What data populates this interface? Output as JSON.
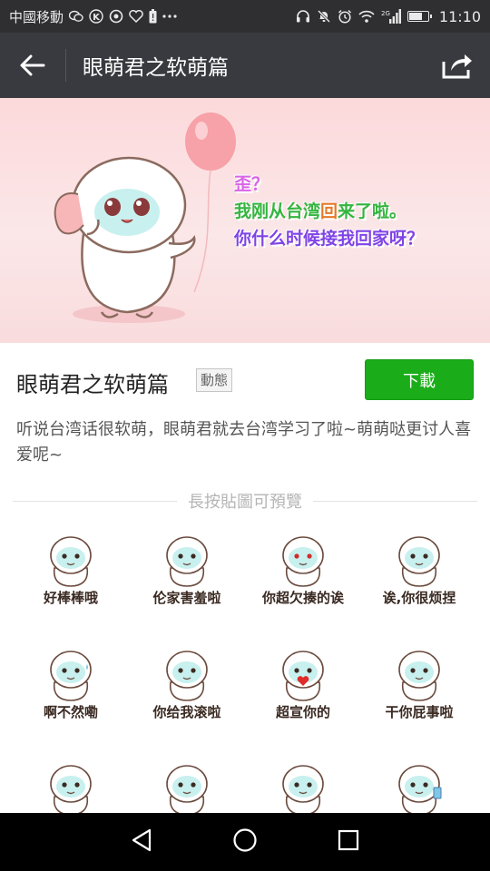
{
  "status_bar": {
    "carrier": "中國移動",
    "signal": "2G",
    "time": "11:10",
    "battery_level": 0.75,
    "icons": [
      "wechat-icon",
      "k-icon",
      "sync-icon",
      "heart-icon",
      "battery-alert-icon",
      "more-icon",
      "headset-icon",
      "mute-icon",
      "alarm-icon",
      "wifi-icon",
      "signal-icon",
      "battery-icon"
    ]
  },
  "nav": {
    "title": "眼萌君之软萌篇",
    "back_icon": "arrow-left-icon",
    "share_icon": "share-icon"
  },
  "banner": {
    "line1": "歪？",
    "line2_a": "我刚从台湾",
    "line2_b": "回",
    "line2_c": "来了啦。",
    "line3": "你什么时候接我回家呀？",
    "colors": {
      "line1": "#d964e8",
      "line2": "#35b53f",
      "line3": "#7f44e6"
    }
  },
  "pack": {
    "title": "眼萌君之软萌篇",
    "tag": "動態",
    "download_label": "下載",
    "description": "听说台湾话很软萌，眼萌君就去台湾学习了啦~萌萌哒更讨人喜爱呢~",
    "accent_color": "#1aad19"
  },
  "preview_hint": "長按貼圖可預覽",
  "stickers": [
    {
      "caption": "好棒棒哦"
    },
    {
      "caption": "伦家害羞啦"
    },
    {
      "caption": "你超欠揍的诶"
    },
    {
      "caption": "诶,你很烦捏"
    },
    {
      "caption": "啊不然嘞"
    },
    {
      "caption": "你给我滚啦"
    },
    {
      "caption": "超宣你的"
    },
    {
      "caption": "干你屁事啦"
    },
    {
      "caption": ""
    },
    {
      "caption": ""
    },
    {
      "caption": ""
    },
    {
      "caption": ""
    }
  ],
  "android_nav": [
    "back-triangle-icon",
    "home-circle-icon",
    "recents-square-icon"
  ]
}
